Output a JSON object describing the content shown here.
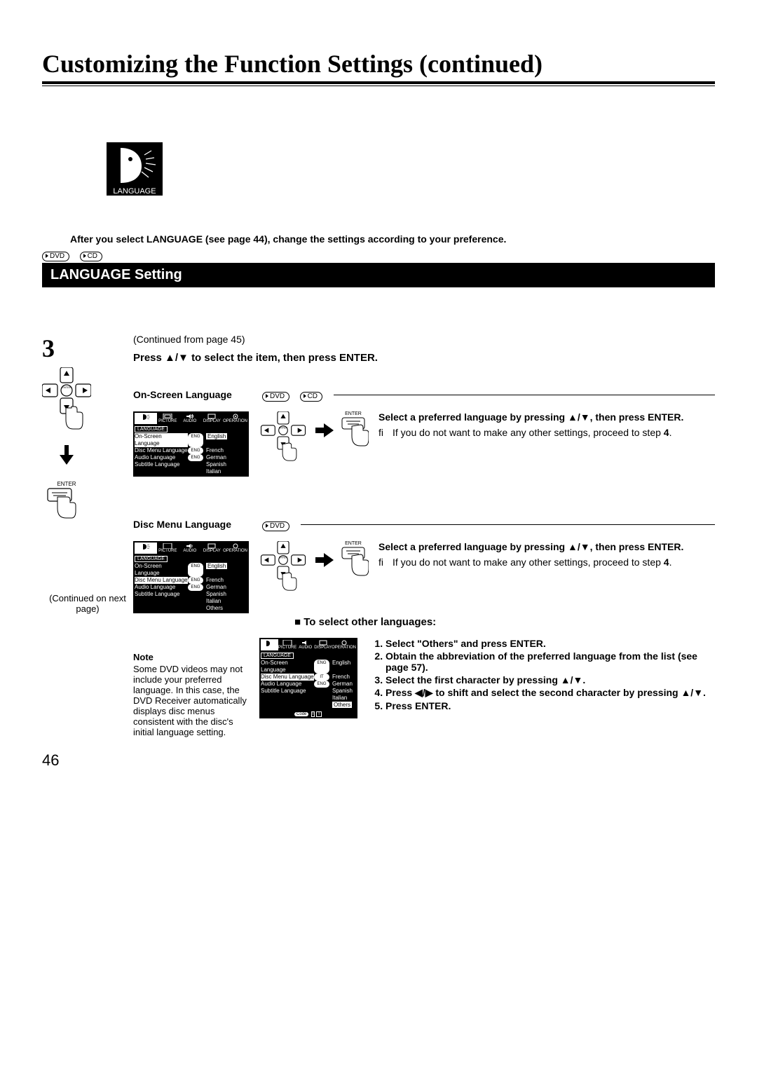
{
  "page": {
    "title": "Customizing the Function Settings (continued)",
    "number": "46"
  },
  "langIcon": {
    "label": "LANGUAGE"
  },
  "intro": "After you select LANGUAGE (see page 44), change the settings according to your preference.",
  "badges": {
    "dvd": "DVD",
    "cd": "CD"
  },
  "sectionBar": "LANGUAGE Setting",
  "step": {
    "num": "3",
    "continuedFrom": "(Continued from page 45)",
    "instruction": "Press ▲/▼ to select the item, then press ENTER.",
    "enterLabel": "ENTER",
    "continuedNext": "(Continued on next page)"
  },
  "sub1": {
    "label": "On-Screen Language",
    "selectInstr": "Select a preferred language by pressing ▲/▼, then press ENTER.",
    "note": "If you do not want to make any other settings, proceed to step ",
    "noteStep": "4",
    "notePunct": "."
  },
  "sub2": {
    "label": "Disc Menu Language",
    "selectInstr": "Select a preferred language by pressing ▲/▼, then press ENTER.",
    "note": "If you do not want to make any other settings, proceed to step ",
    "noteStep": "4",
    "notePunct": "."
  },
  "subhead": "■ To select other languages:",
  "othersSteps": {
    "s1": "Select \"Others\" and press ENTER.",
    "s2": "Obtain the abbreviation of the preferred language from the list (see page 57).",
    "s3": "Select the first character by pressing ▲/▼.",
    "s4": "Press ◀/▶ to shift and select the second character by pressing ▲/▼.",
    "s5": "Press ENTER."
  },
  "noteBlock": {
    "heading": "Note",
    "body": "Some DVD videos may not include your preferred language. In this case, the DVD Receiver automatically displays disc menus consistent with the disc's initial language setting."
  },
  "osd": {
    "cat": "LANGUAGE",
    "tabs": {
      "picture": "PICTURE",
      "audio": "AUDIO",
      "display": "DISPLAY",
      "operation": "OPERATION"
    },
    "rows": {
      "osl": {
        "k": "On-Screen Language",
        "v": "ENG"
      },
      "dml": {
        "k": "Disc Menu Language",
        "v": "ENG"
      },
      "dmlIT": {
        "k": "Disc Menu Language",
        "v": "IT"
      },
      "al": {
        "k": "Audio Language",
        "v": "ENG"
      },
      "sl": {
        "k": "Subtitle Language",
        "v": ""
      }
    },
    "opts": {
      "english": "English",
      "french": "French",
      "german": "German",
      "spanish": "Spanish",
      "italian": "Italian",
      "others": "Others"
    },
    "code": {
      "label": "Code",
      "c1": "I",
      "c2": "T"
    }
  },
  "enterLabelSmall": "ENTER"
}
